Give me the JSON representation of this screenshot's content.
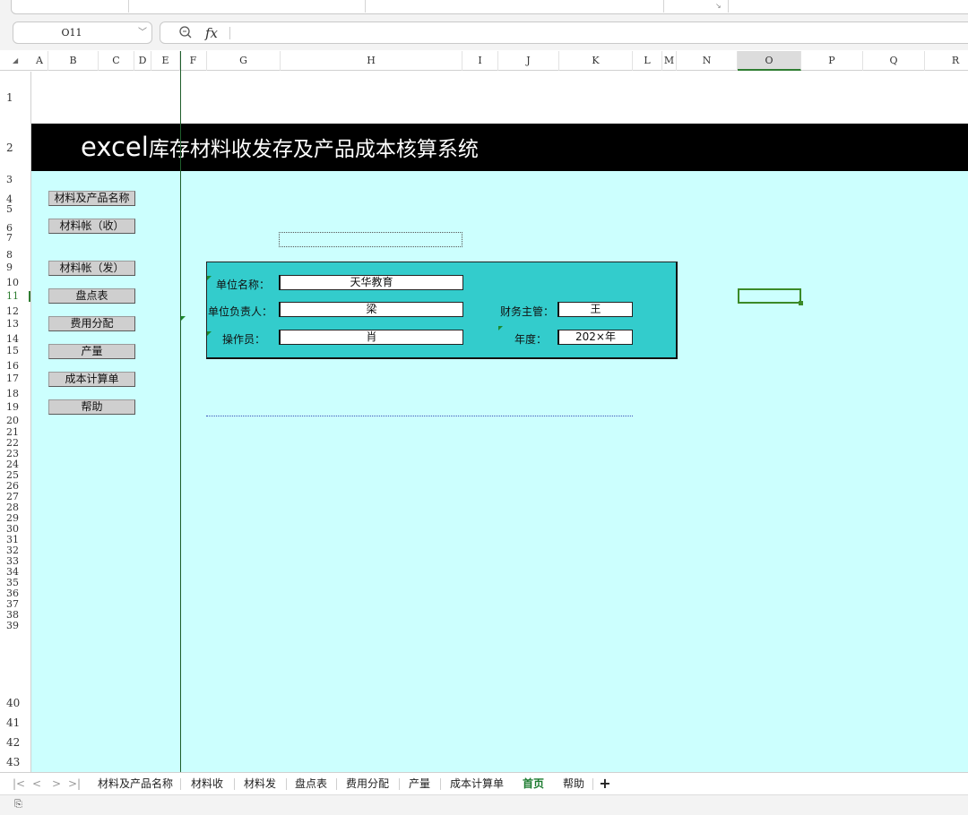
{
  "name_box": {
    "value": "O11"
  },
  "columns": [
    "A",
    "B",
    "C",
    "D",
    "E",
    "F",
    "G",
    "H",
    "I",
    "J",
    "K",
    "L",
    "M",
    "N",
    "O",
    "P",
    "Q",
    "R"
  ],
  "rows": [
    "1",
    "2",
    "3",
    "4",
    "5",
    "6",
    "7",
    "8",
    "9",
    "10",
    "11",
    "12",
    "13",
    "14",
    "15",
    "16",
    "17",
    "18",
    "19",
    "20",
    "21",
    "22",
    "23",
    "24",
    "25",
    "26",
    "27",
    "28",
    "29",
    "30",
    "31",
    "32",
    "33",
    "34",
    "35",
    "36",
    "37",
    "38",
    "39",
    "40",
    "41",
    "42",
    "43"
  ],
  "selected_cell": {
    "column": "O",
    "row": "11"
  },
  "title": {
    "prefix": "excel",
    "text": "库存材料收发存及产品成本核算系统"
  },
  "nav_buttons": [
    "材料及产品名称",
    "材料帐（收）",
    "材料帐（发）",
    "盘点表",
    "费用分配",
    "产量",
    "成本计算单",
    "帮助"
  ],
  "info_panel": {
    "unit_name_label": "单位名称：",
    "unit_name_value": "天华教育",
    "unit_head_label": "单位负责人：",
    "unit_head_value": "梁",
    "finance_supervisor_label": "财务主管：",
    "finance_supervisor_value": "王",
    "operator_label": "操作员：",
    "operator_value": "肖",
    "year_label": "年度：",
    "year_value": "202×年"
  },
  "sheet_tabs": [
    "材料及产品名称",
    "材料收",
    "材料发",
    "盘点表",
    "费用分配",
    "产量",
    "成本计算单",
    "首页",
    "帮助"
  ],
  "active_tab": "首页",
  "colors": {
    "title_bg": "#000000",
    "sheet_bg": "#ccfffe",
    "panel_bg": "#33cccc",
    "active_tab": "#1a7a2e",
    "selection": "#3b8a28"
  }
}
